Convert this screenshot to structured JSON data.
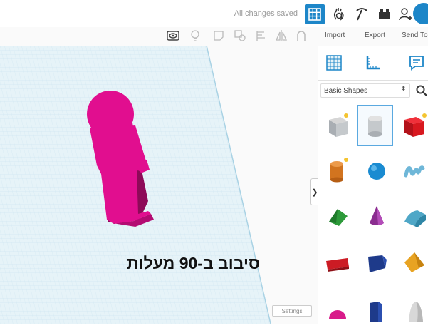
{
  "topbar": {
    "saved_status": "All changes saved",
    "icons": [
      "grid-view-icon",
      "tinker-icon",
      "build-icon",
      "lego-icon",
      "add-user-icon",
      "avatar"
    ]
  },
  "toolbar": {
    "actions": [
      "Import",
      "Export",
      "Send To"
    ],
    "tools": [
      "show-all-icon",
      "lightbulb-icon",
      "note-icon",
      "group-icon",
      "align-icon",
      "mirror-icon",
      "magnet-icon"
    ]
  },
  "workplane": {
    "caption": "סיבוב ב-90 מעלות",
    "settings_label": "Settings",
    "collapse_glyph": "❯",
    "grid_color": "#bfe0ee",
    "shape_color": "#e10e8f"
  },
  "panel": {
    "tabs": [
      "workplane-icon",
      "ruler-icon",
      "notes-icon"
    ],
    "category": "Basic Shapes",
    "shapes": [
      [
        "box-hole",
        "cylinder-hole",
        "box"
      ],
      [
        "cylinder",
        "sphere",
        "scribble"
      ],
      [
        "roof",
        "cone",
        "round-roof"
      ],
      [
        "text",
        "prism",
        "pyramid"
      ],
      [
        "half-sphere",
        "polygon",
        "paraboloid"
      ]
    ]
  }
}
